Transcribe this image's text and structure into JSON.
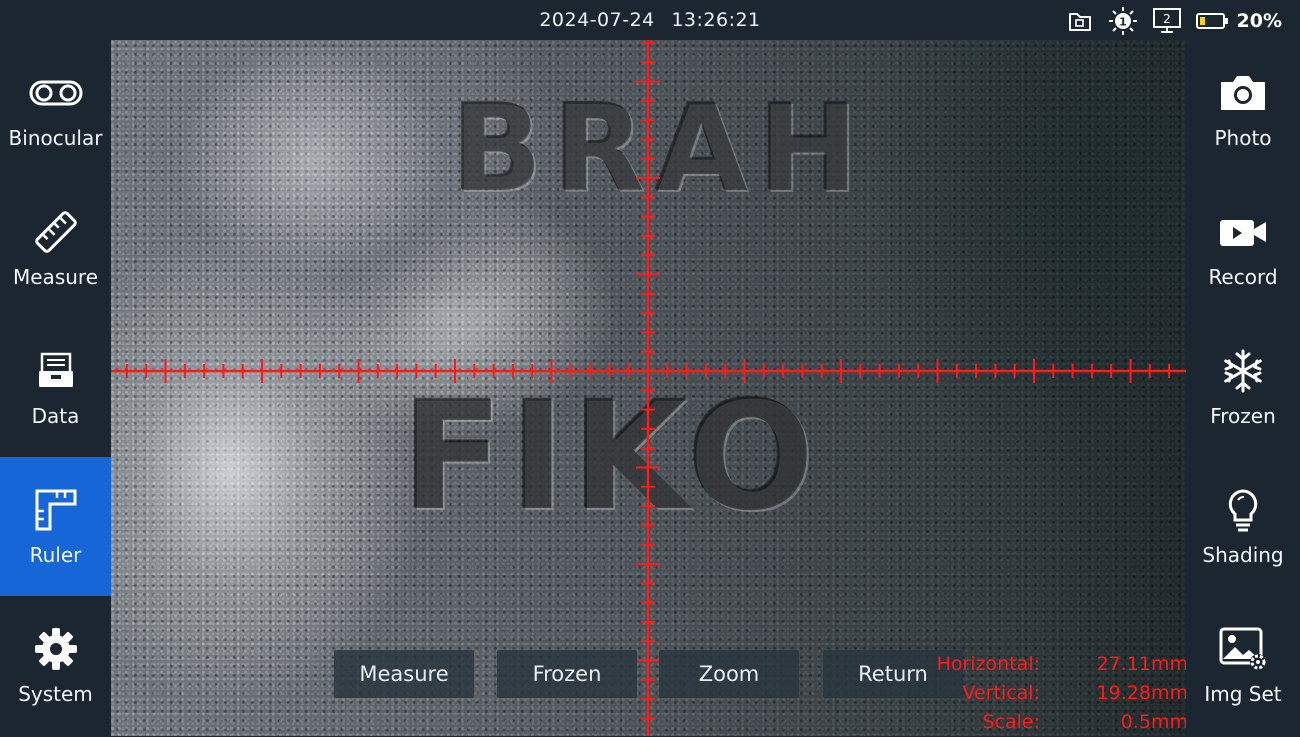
{
  "status_bar": {
    "date": "2024-07-24",
    "time": "13:26:21",
    "light_level": "1",
    "screen_number": "2",
    "battery_percent": "20%"
  },
  "left_nav": [
    {
      "label": "Binocular",
      "icon": "binocular-icon"
    },
    {
      "label": "Measure",
      "icon": "ruler-diagonal-icon"
    },
    {
      "label": "Data",
      "icon": "data-box-icon"
    },
    {
      "label": "Ruler",
      "icon": "ruler-square-icon",
      "active": true
    },
    {
      "label": "System",
      "icon": "gear-icon"
    }
  ],
  "right_nav": [
    {
      "label": "Photo",
      "icon": "camera-icon"
    },
    {
      "label": "Record",
      "icon": "video-camera-icon"
    },
    {
      "label": "Frozen",
      "icon": "snowflake-icon"
    },
    {
      "label": "Shading",
      "icon": "lightbulb-icon"
    },
    {
      "label": "Img Set",
      "icon": "image-settings-icon"
    }
  ],
  "bottom_buttons": {
    "measure": "Measure",
    "frozen": "Frozen",
    "zoom": "Zoom",
    "return": "Return"
  },
  "readout": {
    "horizontal_label": "Horizontal:",
    "horizontal_value": "27.11mm",
    "vertical_label": "Vertical:",
    "vertical_value": "19.28mm",
    "scale_label": "Scale:",
    "scale_value": "0.5mm"
  },
  "colors": {
    "accent_active": "#1666d8",
    "reticle": "#ff1a1a",
    "panel_bg": "#1b2630"
  }
}
